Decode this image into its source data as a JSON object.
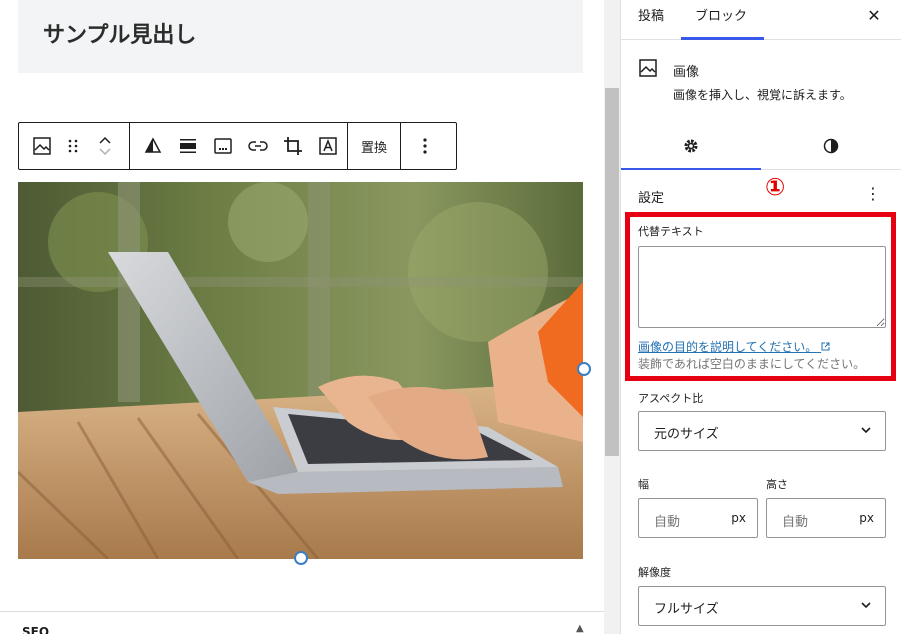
{
  "editor": {
    "heading": "サンプル見出し",
    "toolbar": {
      "replace_label": "置換"
    },
    "seo_panel": {
      "label": "SEO"
    }
  },
  "sidebar": {
    "tabs": {
      "post": "投稿",
      "block": "ブロック"
    },
    "block_card": {
      "title": "画像",
      "description": "画像を挿入し、視覚に訴えます。"
    },
    "panel_title": "設定",
    "callout_marker": "①",
    "alt_text": {
      "label": "代替テキスト",
      "value": "",
      "help_link": "画像の目的を説明してください。",
      "help_text": "装飾であれば空白のままにしてください。"
    },
    "aspect_ratio": {
      "label": "アスペクト比",
      "value": "元のサイズ"
    },
    "width": {
      "label": "幅",
      "placeholder": "自動",
      "unit": "px"
    },
    "height": {
      "label": "高さ",
      "placeholder": "自動",
      "unit": "px"
    },
    "resolution": {
      "label": "解像度",
      "value": "フルサイズ"
    }
  },
  "colors": {
    "accent": "#3858e9",
    "highlight": "#e60012",
    "link": "#2271b1"
  }
}
